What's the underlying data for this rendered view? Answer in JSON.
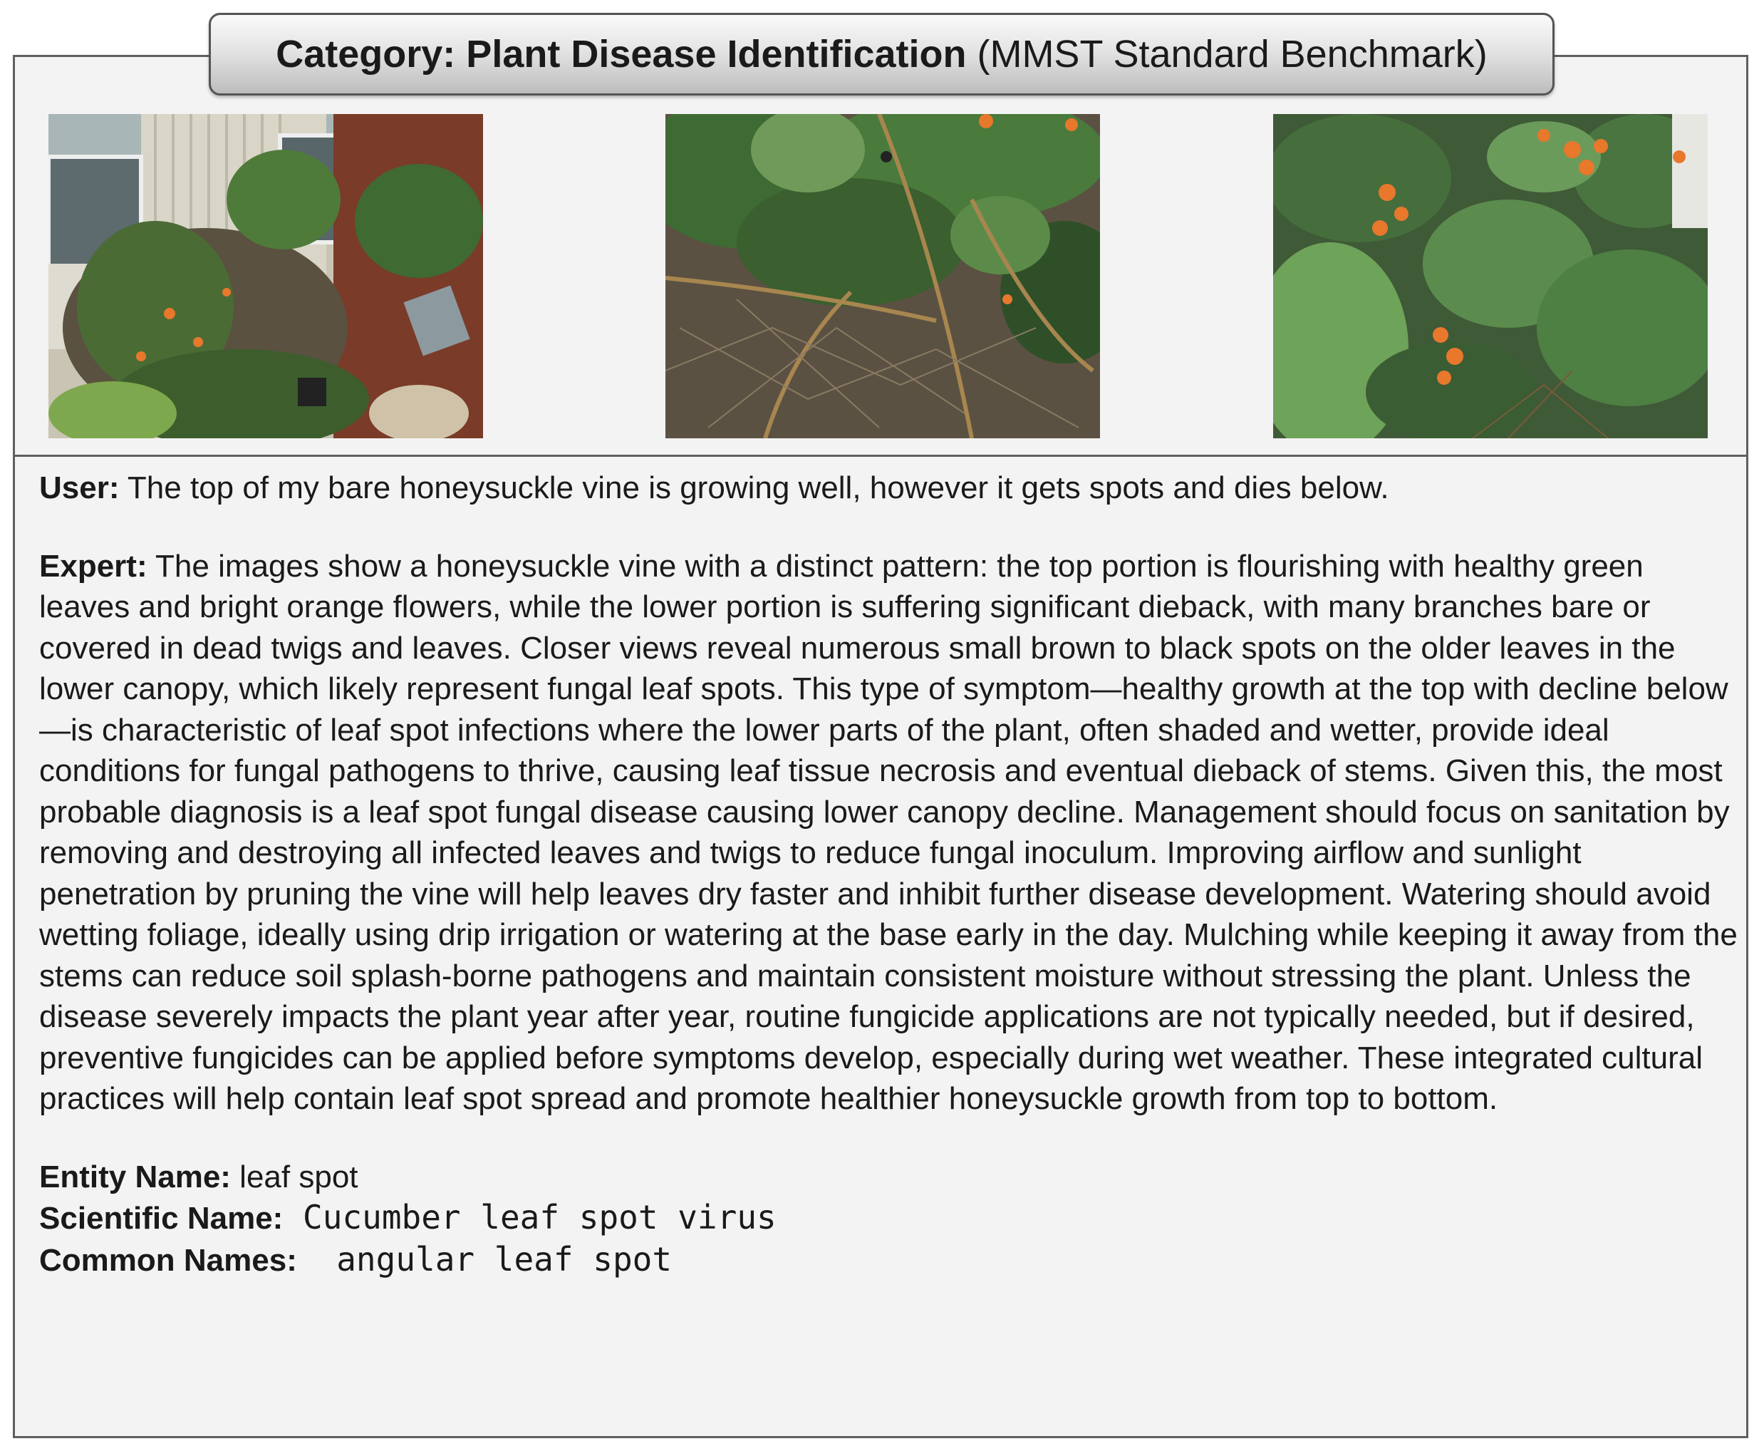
{
  "header": {
    "category_bold": "Category: Plant Disease Identification",
    "category_rest": " (MMST Standard Benchmark)"
  },
  "images": [
    {
      "name": "honeysuckle-vine-on-trellis-photo"
    },
    {
      "name": "lower-canopy-dieback-closeup-photo"
    },
    {
      "name": "healthy-top-with-orange-flowers-photo"
    }
  ],
  "dialog": {
    "user_label": "User:",
    "user_text": " The top of my bare honeysuckle vine is growing well, however it gets spots and dies below.",
    "expert_label": "Expert:",
    "expert_text": " The images show a honeysuckle vine with a distinct pattern: the top portion is flourishing with healthy green leaves and bright orange flowers, while the lower portion is suffering significant dieback, with many branches bare or covered in dead twigs and leaves. Closer views reveal numerous small brown to black spots on the older leaves in the lower canopy, which likely represent fungal leaf spots. This type of symptom—healthy growth at the top with decline below—is characteristic of leaf spot infections where the lower parts of the plant, often shaded and wetter, provide ideal conditions for fungal pathogens to thrive, causing leaf tissue necrosis and eventual dieback of stems. Given this, the most probable diagnosis is a leaf spot fungal disease causing lower canopy decline. Management should focus on sanitation by removing and destroying all infected leaves and twigs to reduce fungal inoculum. Improving airflow and sunlight penetration by pruning the vine will help leaves dry faster and inhibit further disease development. Watering should avoid wetting foliage, ideally using drip irrigation or watering at the base early in the day. Mulching while keeping it away from the stems can reduce soil splash-borne pathogens and maintain consistent moisture without stressing the plant. Unless the disease severely impacts the plant year after year, routine fungicide applications are not typically needed, but if desired, preventive fungicides can be applied before symptoms develop, especially during wet weather. These integrated cultural practices will help contain leaf spot spread and promote healthier honeysuckle growth from top to bottom."
  },
  "entity": {
    "entity_label": "Entity Name:",
    "entity_value": " leaf spot",
    "scientific_label": "Scientific Name:",
    "scientific_value": " Cucumber leaf spot virus",
    "common_label": "Common Names:",
    "common_value": "  angular leaf spot"
  }
}
